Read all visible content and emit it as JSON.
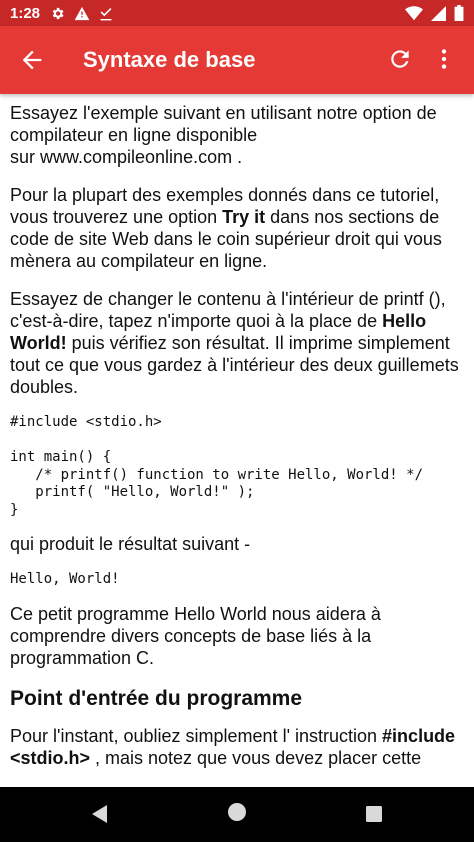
{
  "status_bar": {
    "time": "1:28",
    "left_icons": [
      "gear-icon",
      "warning-icon",
      "download-check-icon"
    ],
    "right_icons": [
      "wifi-icon",
      "cell-signal-icon",
      "battery-icon"
    ]
  },
  "app_bar": {
    "title": "Syntaxe de base",
    "back_icon": "arrow-left-icon",
    "refresh_icon": "refresh-icon",
    "menu_icon": "more-vert-icon",
    "color": "#e53935"
  },
  "content": {
    "p1": "Essayez l'exemple suivant en utilisant notre option de compilateur en ligne disponible",
    "p1_line2": "sur www.compileonline.com .",
    "p2_a": "Pour la plupart des exemples donnés dans ce tutoriel, vous trouverez une option ",
    "p2_bold": "Try it",
    "p2_b": " dans nos sections de code de site Web dans le coin supérieur droit qui vous mènera au compilateur en ligne.",
    "p3_a": "Essayez de changer le contenu à l'intérieur de printf (), c'est-à-dire, tapez n'importe quoi à la place de ",
    "p3_bold": "Hello World!",
    "p3_b": " puis vérifiez son résultat. Il imprime simplement tout ce que vous gardez à l'intérieur des deux guillemets doubles.",
    "code1": "#include <stdio.h>\n\nint main() {\n   /* printf() function to write Hello, World! */\n   printf( \"Hello, World!\" );\n}",
    "p4": "qui produit le résultat suivant -",
    "code2": "Hello, World!",
    "p5": "Ce petit programme Hello World nous aidera à comprendre divers concepts de base liés à la programmation C.",
    "h2": "Point d'entrée du programme",
    "p6_a": "Pour l'instant, oubliez simplement l' instruction ",
    "p6_bold": "#include <stdio.h>",
    "p6_b": " , mais notez que vous devez placer cette"
  },
  "nav_bar": {
    "icons": [
      "nav-back-icon",
      "nav-home-icon",
      "nav-recents-icon"
    ]
  }
}
